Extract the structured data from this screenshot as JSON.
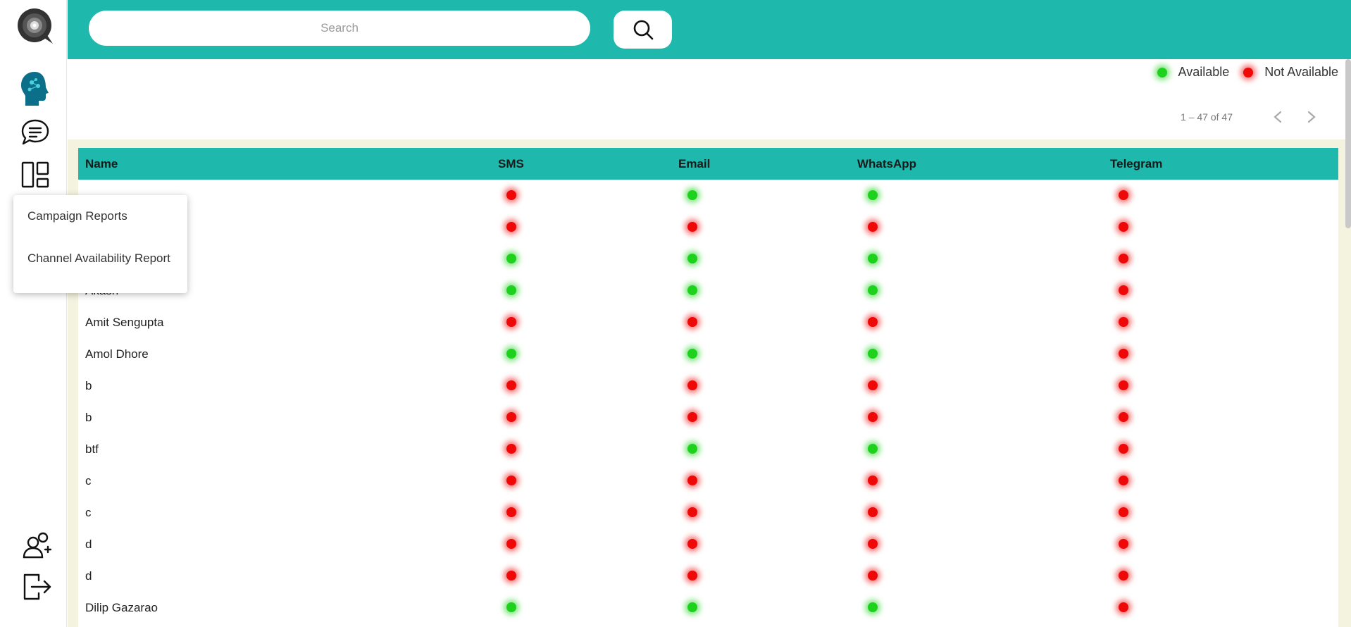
{
  "search": {
    "placeholder": "Search"
  },
  "legend": {
    "available": "Available",
    "not_available": "Not Available",
    "available_color": "#1dd11d",
    "not_available_color": "#ee0808"
  },
  "pager": {
    "range": "1 – 47 of 47"
  },
  "table": {
    "columns": [
      "Name",
      "SMS",
      "Email",
      "WhatsApp",
      "Telegram"
    ],
    "rows": [
      {
        "name": "",
        "sms": false,
        "email": true,
        "whatsapp": true,
        "telegram": false
      },
      {
        "name": "",
        "sms": false,
        "email": false,
        "whatsapp": false,
        "telegram": false
      },
      {
        "name": "",
        "sms": true,
        "email": true,
        "whatsapp": true,
        "telegram": false
      },
      {
        "name": "Akash",
        "sms": true,
        "email": true,
        "whatsapp": true,
        "telegram": false
      },
      {
        "name": "Amit Sengupta",
        "sms": false,
        "email": false,
        "whatsapp": false,
        "telegram": false
      },
      {
        "name": "Amol Dhore",
        "sms": true,
        "email": true,
        "whatsapp": true,
        "telegram": false
      },
      {
        "name": "b",
        "sms": false,
        "email": false,
        "whatsapp": false,
        "telegram": false
      },
      {
        "name": "b",
        "sms": false,
        "email": false,
        "whatsapp": false,
        "telegram": false
      },
      {
        "name": "btf",
        "sms": false,
        "email": true,
        "whatsapp": true,
        "telegram": false
      },
      {
        "name": "c",
        "sms": false,
        "email": false,
        "whatsapp": false,
        "telegram": false
      },
      {
        "name": "c",
        "sms": false,
        "email": false,
        "whatsapp": false,
        "telegram": false
      },
      {
        "name": "d",
        "sms": false,
        "email": false,
        "whatsapp": false,
        "telegram": false
      },
      {
        "name": "d",
        "sms": false,
        "email": false,
        "whatsapp": false,
        "telegram": false
      },
      {
        "name": "Dilip Gazarao",
        "sms": true,
        "email": true,
        "whatsapp": true,
        "telegram": false
      }
    ]
  },
  "dropdown": {
    "items": [
      "Campaign Reports",
      "Channel Availability Report"
    ]
  },
  "colors": {
    "accent": "#1eb8ac",
    "content_bg": "#f3f3e0"
  }
}
